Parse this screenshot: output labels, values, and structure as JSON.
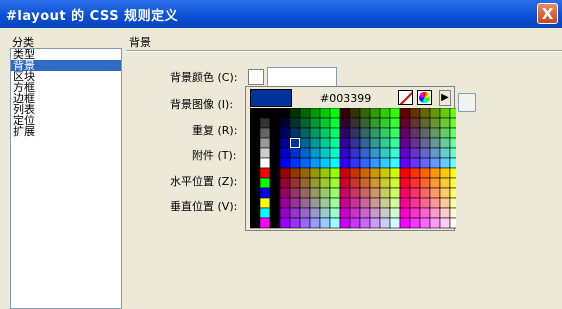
{
  "window": {
    "title": "#layout 的 CSS 规则定义",
    "close_glyph": "X"
  },
  "category_label": "分类",
  "categories": [
    {
      "label": "类型",
      "selected": false
    },
    {
      "label": "背景",
      "selected": true
    },
    {
      "label": "区块",
      "selected": false
    },
    {
      "label": "方框",
      "selected": false
    },
    {
      "label": "边框",
      "selected": false
    },
    {
      "label": "列表",
      "selected": false
    },
    {
      "label": "定位",
      "selected": false
    },
    {
      "label": "扩展",
      "selected": false
    }
  ],
  "section_title": "背景",
  "fields": [
    {
      "label": "背景颜色 (C):"
    },
    {
      "label": "背景图像 (I):"
    },
    {
      "label": "重复 (R):"
    },
    {
      "label": "附件 (T):"
    },
    {
      "label": "水平位置 (Z):"
    },
    {
      "label": "垂直位置 (V):"
    }
  ],
  "color_picker": {
    "preview_color": "#003399",
    "hex_value": "#003399",
    "menu_arrow": "▶",
    "selected_color": "#003399"
  }
}
